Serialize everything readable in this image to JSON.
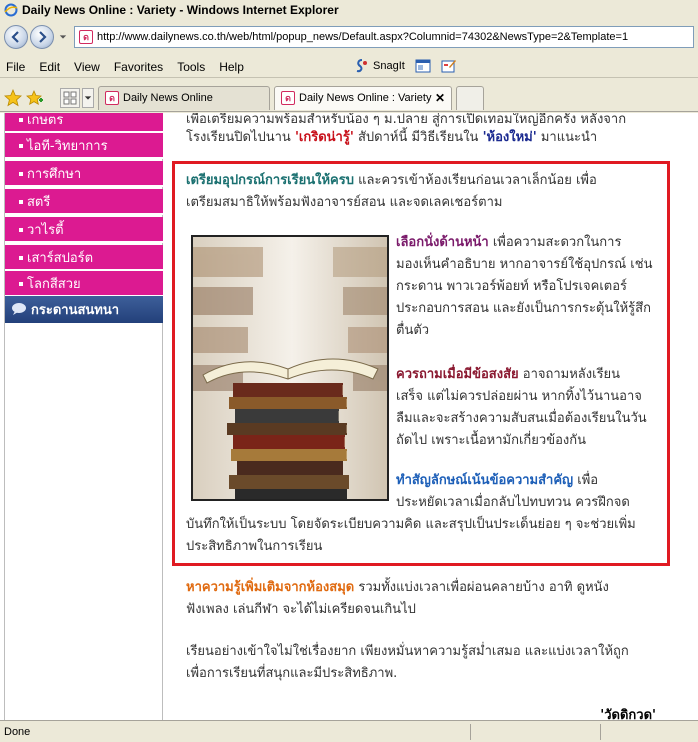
{
  "window": {
    "title": "Daily News Online : Variety - Windows Internet Explorer"
  },
  "address": {
    "url": "http://www.dailynews.co.th/web/html/popup_news/Default.aspx?Columnid=74302&NewsType=2&Template=1"
  },
  "menu": {
    "items": [
      "File",
      "Edit",
      "View",
      "Favorites",
      "Tools",
      "Help"
    ],
    "snagit_label": "SnagIt"
  },
  "tabs": [
    {
      "label": "Daily News Online",
      "active": false
    },
    {
      "label": "Daily News Online : Variety",
      "active": true
    }
  ],
  "sidebar": {
    "items": [
      "เกษตร",
      "ไอที-วิทยาการ",
      "การศึกษา",
      "สตรี",
      "วาไรตี้",
      "เสาร์สปอร์ต",
      "โลกสีสวย"
    ],
    "forum_label": "กระดานสนทนา"
  },
  "article": {
    "intro_line1_a": "เพื่อเตรียมความพร้อมสำหรับน้อง ๆ ม.ปลาย สู่การเปิดเทอมใหญ่อีกครั้ง หลังจาก",
    "intro_line2_a": "โรงเรียนปิดไปนาน ",
    "intro_kerd": "'เกริดน่ารู้'",
    "intro_line2_b": " สัปดาห์นี้ มีวิธีเรียนใน ",
    "intro_room": "'ห้องใหม่'",
    "intro_line2_c": " มาแนะนำ",
    "tip1_title": "เตรียมอุปกรณ์การเรียนให้ครบ",
    "tip1_line1_rest": " และควรเข้าห้องเรียนก่อนเวลาเล็กน้อย เพื่อ",
    "tip1_line2": "เตรียมสมาธิให้พร้อมฟังอาจารย์สอน และจดเลคเชอร์ตาม",
    "tip2_title": "เลือกนั่งด้านหน้า",
    "tip2_line1_rest": " เพื่อความสะดวกในการ",
    "tip2_line2": "มองเห็นคำอธิบาย หากอาจารย์ใช้อุปกรณ์ เช่น",
    "tip2_line3": "กระดาน พาวเวอร์พ้อยท์ หรือโปรเจคเตอร์",
    "tip2_line4": "ประกอบการสอน และยังเป็นการกระตุ้นให้รู้สึก",
    "tip2_line5": "ตื่นตัว",
    "tip3_title": "ควรถามเมื่อมีข้อสงสัย",
    "tip3_line1_rest": " อาจถามหลังเรียน",
    "tip3_line2": "เสร็จ แต่ไม่ควรปล่อยผ่าน หากทิ้งไว้นานอาจ",
    "tip3_line3": "ลืมและจะสร้างความสับสนเมื่อต้องเรียนในวัน",
    "tip3_line4": "ถัดไป เพราะเนื้อหามักเกี่ยวข้องกัน",
    "tip4_title": "ทำสัญลักษณ์เน้นข้อความสำคัญ",
    "tip4_line1_rest": " เพื่อ",
    "tip4_line2": "ประหยัดเวลาเมื่อกลับไปทบทวน ควรฝึกจด",
    "tip4_line3": "บันทึกให้เป็นระบบ โดยจัดระเบียบความคิด และสรุปเป็นประเด็นย่อย ๆ จะช่วยเพิ่ม",
    "tip4_line4": "ประสิทธิภาพในการเรียน",
    "tip5_title": "หาความรู้เพิ่มเติมจากห้องสมุด",
    "tip5_line1_rest": " รวมทั้งแบ่งเวลาเพื่อผ่อนคลายบ้าง อาทิ ดูหนัง",
    "tip5_line2": "ฟังเพลง เล่นกีฬา จะได้ไม่เครียดจนเกินไป",
    "outro_line1": "เรียนอย่างเข้าใจไม่ใช่เรื่องยาก เพียงหมั่นหาความรู้สม่ำเสมอ และแบ่งเวลาให้ถูก",
    "outro_line2": "เพื่อการเรียนที่สนุกและมีประสิทธิภาพ.",
    "byline": "'วัดดิกวด'"
  },
  "status": {
    "text": "Done"
  }
}
